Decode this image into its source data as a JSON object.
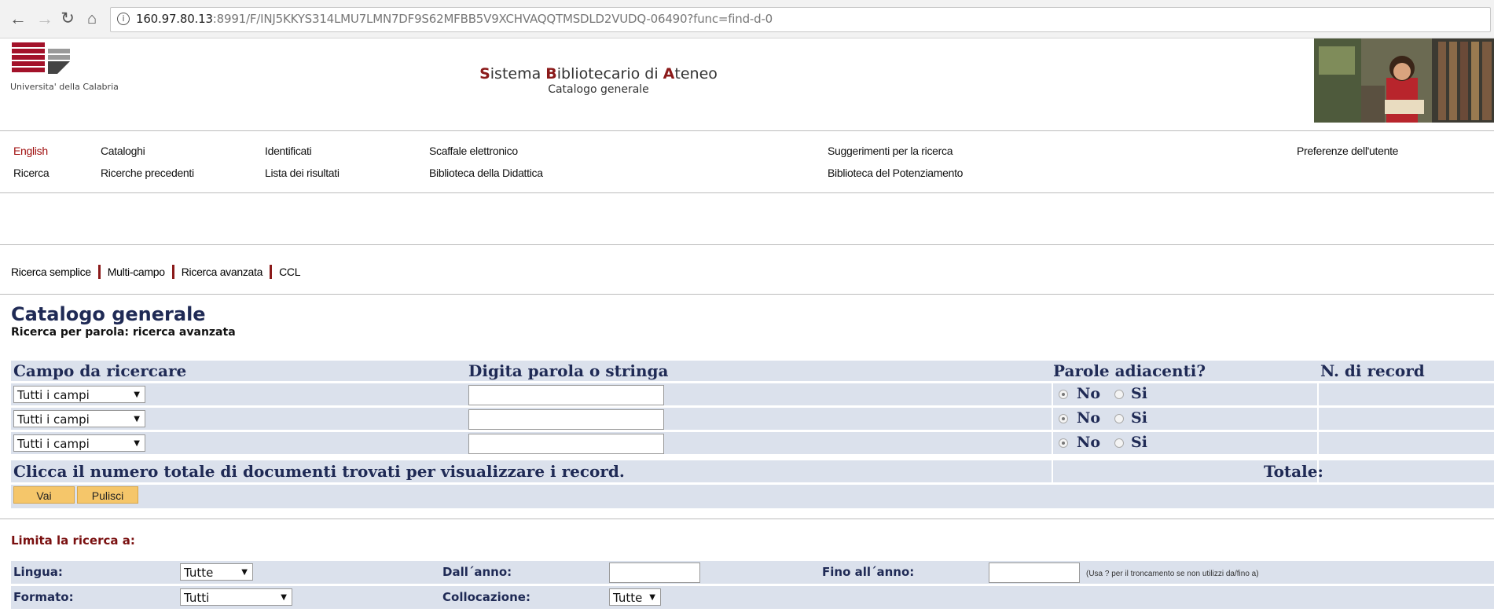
{
  "browser": {
    "back_icon": "arrow-left-icon",
    "forward_icon": "arrow-right-icon",
    "reload_icon": "reload-icon",
    "home_icon": "home-icon",
    "url_host": "160.97.80.13",
    "url_rest": ":8991/F/INJ5KKYS314LMU7LMN7DF9S62MFBB5V9XCHVAQQTMSDLD2VUDQ-06490?func=find-d-0"
  },
  "header": {
    "university": "Universita' della Calabria",
    "title_parts": [
      "S",
      "istema ",
      "B",
      "ibliotecario di ",
      "A",
      "teneo"
    ],
    "subtitle": "Catalogo generale"
  },
  "nav": {
    "row1": [
      "English",
      "Cataloghi",
      "Identificati",
      "Scaffale elettronico",
      "Suggerimenti per la ricerca",
      "Preferenze dell'utente"
    ],
    "row2": [
      "Ricerca",
      "Ricerche precedenti",
      "Lista dei risultati",
      "Biblioteca della Didattica",
      "Biblioteca del Potenziamento"
    ]
  },
  "tabs": [
    "Ricerca semplice",
    "Multi-campo",
    "Ricerca avanzata",
    "CCL"
  ],
  "page": {
    "title": "Catalogo generale",
    "subtitle": "Ricerca per parola: ricerca avanzata"
  },
  "form": {
    "headers": {
      "field": "Campo da ricercare",
      "word": "Digita parola o stringa",
      "adjacent": "Parole adiacenti?",
      "records": "N. di record"
    },
    "rows": [
      {
        "field": "Tutti i campi",
        "value": "",
        "adjacent": "No"
      },
      {
        "field": "Tutti i campi",
        "value": "",
        "adjacent": "No"
      },
      {
        "field": "Tutti i campi",
        "value": "",
        "adjacent": "No"
      }
    ],
    "radio_no": "No",
    "radio_si": "Si",
    "click_note": "Clicca il numero totale di documenti trovati per visualizzare i record.",
    "total_label": "Totale:",
    "go_button": "Vai",
    "clear_button": "Pulisci"
  },
  "limits": {
    "title": "Limita la ricerca a:",
    "language_label": "Lingua:",
    "language_value": "Tutte",
    "from_year_label": "Dall´anno:",
    "to_year_label": "Fino all´anno:",
    "year_hint": "(Usa ? per il troncamento se non utilizzi da/fino a)",
    "format_label": "Formato:",
    "format_value": "Tutti",
    "location_label": "Collocazione:",
    "location_value": "Tutte"
  }
}
